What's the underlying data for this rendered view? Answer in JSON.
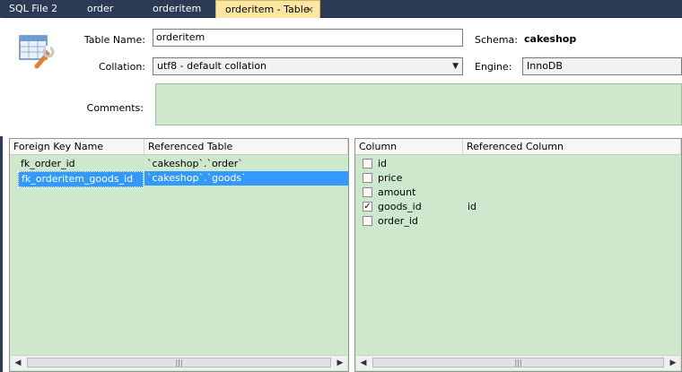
{
  "tabs": [
    {
      "label": "SQL File 2"
    },
    {
      "label": "order"
    },
    {
      "label": "orderitem"
    },
    {
      "label": "orderitem - Table",
      "close": "×"
    }
  ],
  "form": {
    "table_name_label": "Table Name:",
    "table_name_value": "orderitem",
    "schema_label": "Schema:",
    "schema_value": "cakeshop",
    "collation_label": "Collation:",
    "collation_value": "utf8 - default collation",
    "engine_label": "Engine:",
    "engine_value": "InnoDB",
    "comments_label": "Comments:",
    "comments_value": ""
  },
  "fk_panel": {
    "headers": [
      "Foreign Key Name",
      "Referenced Table"
    ],
    "rows": [
      {
        "name": "fk_order_id",
        "table": "`cakeshop`.`order`",
        "selected": false
      },
      {
        "name": "fk_orderitem_goods_id",
        "table": "`cakeshop`.`goods`",
        "selected": true
      }
    ]
  },
  "col_panel": {
    "headers": [
      "Column",
      "Referenced Column"
    ],
    "rows": [
      {
        "column": "id",
        "checked": false,
        "ref": ""
      },
      {
        "column": "price",
        "checked": false,
        "ref": ""
      },
      {
        "column": "amount",
        "checked": false,
        "ref": ""
      },
      {
        "column": "goods_id",
        "checked": true,
        "ref": "id"
      },
      {
        "column": "order_id",
        "checked": false,
        "ref": ""
      }
    ]
  },
  "icons": {
    "table": "table-settings-icon",
    "dropdown": "chevron-down-icon",
    "scroll_left": "arrow-left-icon",
    "scroll_right": "arrow-right-icon",
    "check": "✓"
  },
  "colors": {
    "tabbar": "#2b3a55",
    "active_tab": "#fbe7a1",
    "panel_bg": "#cde8cd",
    "selection": "#3399ff"
  }
}
